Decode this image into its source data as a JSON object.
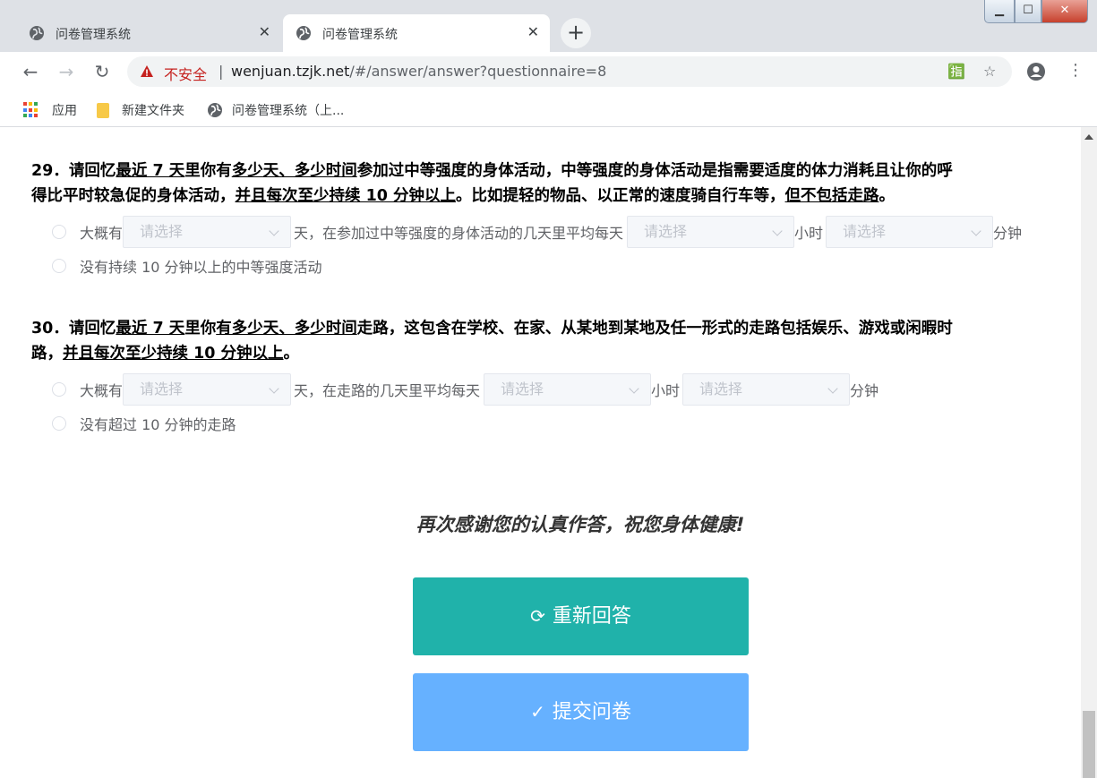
{
  "browser": {
    "tabs": [
      {
        "title": "问卷管理系统",
        "active": false
      },
      {
        "title": "问卷管理系统",
        "active": true
      }
    ],
    "new_tab_icon": "+",
    "security_label": "不安全",
    "url_host": "wenjuan.tzjk.net",
    "url_path": "/#/answer/answer?questionnaire=8",
    "bookmarks": [
      {
        "label": "应用",
        "icon": "apps-grid-icon"
      },
      {
        "label": "新建文件夹",
        "icon": "folder-icon"
      },
      {
        "label": "问卷管理系统（上...",
        "icon": "globe-icon"
      }
    ]
  },
  "questions": [
    {
      "number": "29",
      "text_line1": {
        "p1": "29．请回忆",
        "u1": "最近 7 天",
        "p2": "里你有",
        "u2": "多少天、多少时间",
        "p3": "参加过中等强度的身体活动，中等强度的身体活动是指需要适度的体力消耗且让你的呼"
      },
      "text_line2": {
        "p1": "得比平时较急促的身体活动，",
        "u1": "并且每次至少持续 10 分钟以上",
        "p2": "。比如提轻的物品、以正常的速度骑自行车等，",
        "u2": "但不包括走路",
        "p3": "。"
      },
      "option1": {
        "prefix": "大概有",
        "select1_placeholder": "请选择",
        "mid1": "天，在参加过中等强度的身体活动的几天里平均每天",
        "select2_placeholder": "请选择",
        "mid2": "小时",
        "select3_placeholder": "请选择",
        "suffix": "分钟"
      },
      "option2": "没有持续 10 分钟以上的中等强度活动"
    },
    {
      "number": "30",
      "text_line1": {
        "p1": "30．请回忆",
        "u1": "最近 7 天",
        "p2": "里你",
        "u2": "有多少天、多少时间",
        "p3": "走路，这包含在学校、在家、从某地到某地及任一形式的走路包括娱乐、游戏或闲暇时"
      },
      "text_line2": {
        "p1": "路，",
        "u1": "并且每次至少持续 10 分钟以上",
        "p2": "。"
      },
      "option1": {
        "prefix": "大概有",
        "select1_placeholder": "请选择",
        "mid1": "天，在走路的几天里平均每天",
        "select2_placeholder": "请选择",
        "mid2": "小时",
        "select3_placeholder": "请选择",
        "suffix": "分钟"
      },
      "option2": "没有超过 10 分钟的走路"
    }
  ],
  "footer": {
    "thanks": "再次感谢您的认真作答，祝您身体健康!",
    "redo_label": "重新回答",
    "submit_label": "提交问卷"
  },
  "colors": {
    "redo_button": "#20b2aa",
    "submit_button": "#66b1ff",
    "insecure_text": "#c5221f"
  }
}
